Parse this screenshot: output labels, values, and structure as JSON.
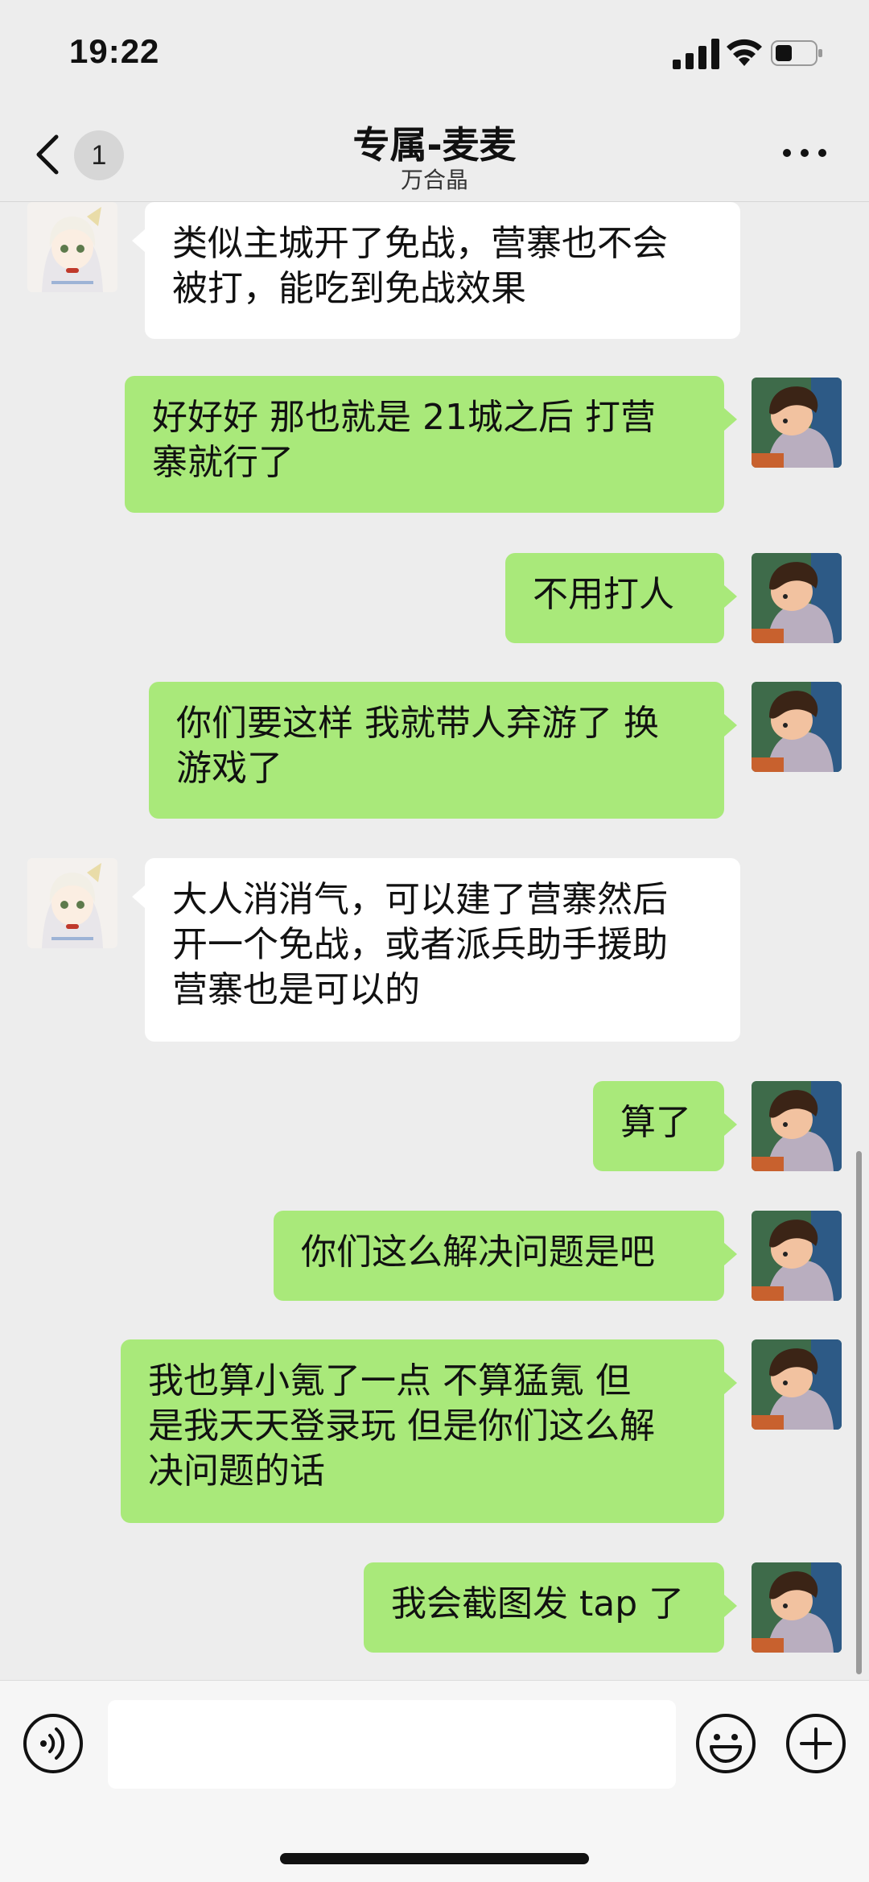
{
  "status_bar": {
    "time": "19:22"
  },
  "nav": {
    "unread_count": "1",
    "title": "专属-麦麦",
    "subtitle": "万合晶"
  },
  "messages": [
    {
      "sender": "other",
      "lines": [
        "类似主城开了免战，营寨也不会",
        "被打，能吃到免战效果"
      ]
    },
    {
      "sender": "me",
      "lines": [
        " 好好好 那也就是 21城之后 打营",
        "寨就行了"
      ]
    },
    {
      "sender": "me",
      "lines": [
        "不用打人"
      ]
    },
    {
      "sender": "me",
      "lines": [
        "你们要这样 我就带人弃游了 换",
        "游戏了"
      ]
    },
    {
      "sender": "other",
      "lines": [
        "大人消消气，可以建了营寨然后",
        "开一个免战，或者派兵助手援助",
        "营寨也是可以的"
      ]
    },
    {
      "sender": "me",
      "lines": [
        "算了"
      ]
    },
    {
      "sender": "me",
      "lines": [
        "你们这么解决问题是吧"
      ]
    },
    {
      "sender": "me",
      "lines": [
        "我也算小氪了一点 不算猛氪 但",
        "是我天天登录玩 但是你们这么解",
        "决问题的话"
      ]
    },
    {
      "sender": "me",
      "lines": [
        "我会截图发 tap 了"
      ]
    }
  ],
  "colors": {
    "background": "#ededed",
    "my_bubble": "#a9e97a",
    "other_bubble": "#ffffff"
  },
  "input_bar": {
    "voice_icon": "voice-icon",
    "emoji_icon": "emoji-icon",
    "add_icon": "plus-circle-icon"
  }
}
